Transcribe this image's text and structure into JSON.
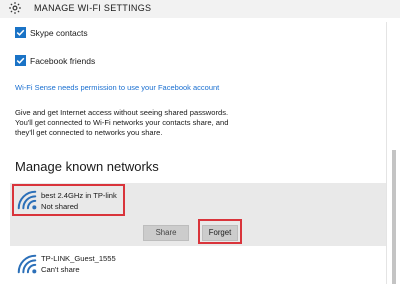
{
  "header": {
    "title": "MANAGE WI-FI SETTINGS",
    "icon": "gear-icon"
  },
  "checkboxes": [
    {
      "label": "Skype contacts",
      "checked": true
    },
    {
      "label": "Facebook friends",
      "checked": true
    }
  ],
  "facebook_link": "Wi-Fi Sense needs permission to use your Facebook account",
  "description": [
    "Give and get Internet access without seeing shared passwords.",
    "You'll get connected to Wi-Fi networks your contacts share, and",
    "they'll get connected to networks you share."
  ],
  "section_title": "Manage known networks",
  "networks": [
    {
      "name": "best 2.4GHz in TP-link",
      "status": "Not shared",
      "selected": true
    },
    {
      "name": "TP-LINK_Guest_1555",
      "status": "Can't share",
      "selected": false
    }
  ],
  "actions": {
    "share_label": "Share",
    "forget_label": "Forget"
  },
  "colors": {
    "accent": "#1a73c6",
    "link": "#1a6fd0",
    "highlight": "#d9343b",
    "panel": "#e9e9e9"
  }
}
